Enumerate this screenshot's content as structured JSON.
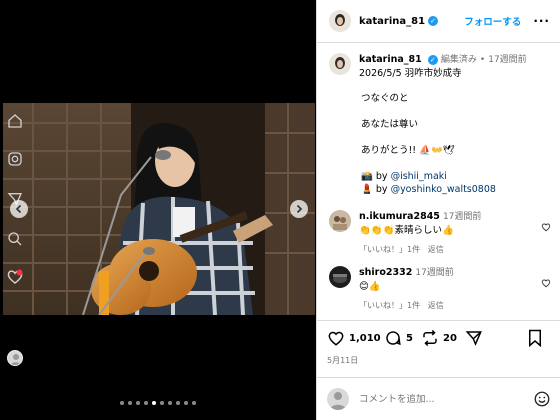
{
  "post": {
    "username": "katarina_81",
    "follow_label": "フォローする",
    "more_label": "···",
    "edited_label": "編集済み",
    "separator": "•",
    "time_ago": "17週間前",
    "caption_lines": [
      "2026/5/5 羽咋市妙成寺",
      "つなぐのと",
      "あなたは尊い",
      "ありがとう!! ⛵👐🕊"
    ],
    "credits": [
      {
        "emoji": "📸",
        "by": "by",
        "handle": "@ishii_maki"
      },
      {
        "emoji": "💄",
        "by": "by",
        "handle": "@yoshinko_walts0808"
      }
    ]
  },
  "comments": [
    {
      "username": "n.ikumura2845",
      "time": "17週間前",
      "text": "👏👏👏素晴らしい👍",
      "likes": "「いいね！」1件",
      "reply": "返信"
    },
    {
      "username": "shiro2332",
      "time": "17週間前",
      "text": "😊👍",
      "likes": "「いいね！」1件",
      "reply": "返信"
    }
  ],
  "actions": {
    "likes": "1,010",
    "comments": "5",
    "reposts": "20",
    "date": "5月11日"
  },
  "composer": {
    "placeholder": "コメントを追加..."
  },
  "carousel": {
    "count": 10,
    "active_index": 4
  },
  "icons": {
    "left_nav": [
      "home-icon",
      "messages-icon",
      "explore-icon",
      "search-icon",
      "notifications-icon"
    ],
    "accent": "#0095f6",
    "notification_dot": "#ff3040"
  }
}
